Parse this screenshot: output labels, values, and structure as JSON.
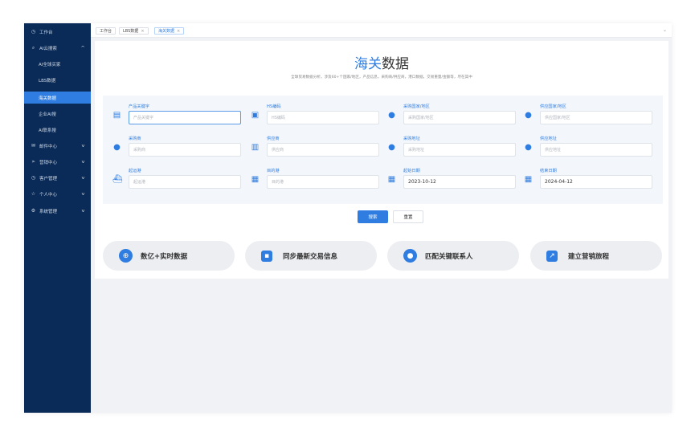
{
  "sidebar": {
    "items": [
      {
        "label": "工作台",
        "icon": "clock-icon",
        "chevron": ""
      },
      {
        "label": "AI云搜索",
        "icon": "search-icon",
        "chevron": "^"
      },
      {
        "label": "AI全球买家",
        "icon": "",
        "chevron": ""
      },
      {
        "label": "LBS数据",
        "icon": "",
        "chevron": ""
      },
      {
        "label": "海关数据",
        "icon": "",
        "chevron": ""
      },
      {
        "label": "企业AI搜",
        "icon": "",
        "chevron": ""
      },
      {
        "label": "AI联系搜",
        "icon": "",
        "chevron": ""
      },
      {
        "label": "邮件中心",
        "icon": "mail-icon",
        "chevron": "v"
      },
      {
        "label": "营销中心",
        "icon": "send-icon",
        "chevron": "v"
      },
      {
        "label": "客户管理",
        "icon": "clock-icon",
        "chevron": "v"
      },
      {
        "label": "个人中心",
        "icon": "star-icon",
        "chevron": "v"
      },
      {
        "label": "系统管理",
        "icon": "gear-icon",
        "chevron": "v"
      }
    ]
  },
  "tabs": [
    {
      "label": "工作台",
      "closable": false
    },
    {
      "label": "LBS数据",
      "closable": true
    },
    {
      "label": "海关数据",
      "closable": true
    }
  ],
  "tab_close_glyph": "×",
  "tab_menu_glyph": "⌄",
  "header": {
    "title_accent": "海关",
    "title_rest": "数据",
    "subtitle": "全球贸易数据分析，涉及60+个国家/地区，产品信息，采购商/供应商，港口数据，交易重量/金额等，尽在其中"
  },
  "search_fields": [
    {
      "label": "产品关键字",
      "placeholder": "产品关键字",
      "value": "",
      "icon": "document-icon"
    },
    {
      "label": "HS编码",
      "placeholder": "HS编码",
      "value": "",
      "icon": "terminal-icon"
    },
    {
      "label": "采购国家/地区",
      "placeholder": "采购国家/地区",
      "value": "",
      "icon": "globe-icon"
    },
    {
      "label": "供应国家/地区",
      "placeholder": "供应国家/地区",
      "value": "",
      "icon": "globe-icon"
    },
    {
      "label": "采购商",
      "placeholder": "采购商",
      "value": "",
      "icon": "user-icon"
    },
    {
      "label": "供应商",
      "placeholder": "供应商",
      "value": "",
      "icon": "store-icon"
    },
    {
      "label": "采购地址",
      "placeholder": "采购地址",
      "value": "",
      "icon": "location-pin-icon"
    },
    {
      "label": "供应地址",
      "placeholder": "供应地址",
      "value": "",
      "icon": "location-pin-icon"
    },
    {
      "label": "起运港",
      "placeholder": "起运港",
      "value": "",
      "icon": "ship-icon"
    },
    {
      "label": "目的港",
      "placeholder": "目的港",
      "value": "",
      "icon": "train-icon"
    },
    {
      "label": "起始日期",
      "placeholder": "",
      "value": "2023-10-12",
      "icon": "calendar-icon"
    },
    {
      "label": "结束日期",
      "placeholder": "",
      "value": "2024-04-12",
      "icon": "calendar-icon"
    }
  ],
  "buttons": {
    "search": "搜索",
    "reset": "重置"
  },
  "features": [
    {
      "label": "数亿+实时数据",
      "icon": "globe-network-icon"
    },
    {
      "label": "同步最新交易信息",
      "icon": "id-card-icon"
    },
    {
      "label": "匹配关键联系人",
      "icon": "contacts-icon"
    },
    {
      "label": "建立营销旅程",
      "icon": "chart-up-icon"
    }
  ],
  "colors": {
    "sidebar_bg": "#0a2b57",
    "accent": "#2f7de1",
    "active_item": "#2f7de1"
  }
}
